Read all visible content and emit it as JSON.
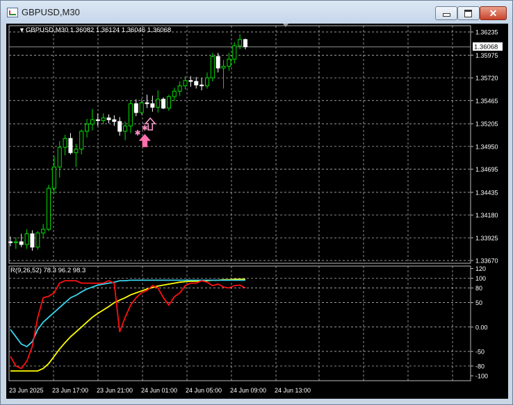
{
  "window": {
    "title": "GBPUSD,M30",
    "controls": {
      "minimize": "minimize",
      "maximize": "maximize",
      "close": "✕"
    }
  },
  "main_chart": {
    "header": "GBPUSD,M30  1.36082 1.36124 1.36046 1.36068",
    "current_price_label": "1.36068",
    "price_labels": [
      "1.36235",
      "1.35975",
      "1.35720",
      "1.35465",
      "1.35205",
      "1.34950",
      "1.34695",
      "1.34435",
      "1.34180",
      "1.33925",
      "1.33670"
    ]
  },
  "indicator": {
    "header": "R(9,26,52) 78.3 96.2 98.3",
    "scale_labels": [
      "120",
      "100",
      "80",
      "50",
      "0.00",
      "-50",
      "-80",
      "-100"
    ]
  },
  "time_axis": {
    "labels": [
      "23 Jun 2025",
      "23 Jun 17:00",
      "23 Jun 21:00",
      "24 Jun 01:00",
      "24 Jun 05:00",
      "24 Jun 09:00",
      "24 Jun 13:00"
    ]
  },
  "colors": {
    "bull": "#00e000",
    "bear": "#ffffff",
    "grid": "#cfcfcf",
    "fast_line": "#ff1010",
    "mid_line": "#3ad6ee",
    "slow_line": "#ffff00",
    "arrow": "#ff6fae",
    "arrow_outline": "#ff9fd0",
    "star": "#ff8fc0"
  },
  "chart_data": {
    "type": "candlestick",
    "symbol": "GBPUSD",
    "timeframe": "M30",
    "x": [
      "23 Jun 14:00",
      "23 Jun 14:30",
      "23 Jun 15:00",
      "23 Jun 15:30",
      "23 Jun 16:00",
      "23 Jun 16:30",
      "23 Jun 17:00",
      "23 Jun 17:30",
      "23 Jun 18:00",
      "23 Jun 18:30",
      "23 Jun 19:00",
      "23 Jun 19:30",
      "23 Jun 20:00",
      "23 Jun 20:30",
      "23 Jun 21:00",
      "23 Jun 21:30",
      "23 Jun 22:00",
      "23 Jun 22:30",
      "23 Jun 23:00",
      "23 Jun 23:30",
      "24 Jun 00:00",
      "24 Jun 00:30",
      "24 Jun 01:00",
      "24 Jun 01:30",
      "24 Jun 02:00",
      "24 Jun 02:30",
      "24 Jun 03:00",
      "24 Jun 03:30",
      "24 Jun 04:00",
      "24 Jun 04:30",
      "24 Jun 05:00",
      "24 Jun 05:30",
      "24 Jun 06:00",
      "24 Jun 06:30",
      "24 Jun 07:00",
      "24 Jun 07:30",
      "24 Jun 08:00",
      "24 Jun 08:30",
      "24 Jun 09:00",
      "24 Jun 09:30",
      "24 Jun 10:00",
      "24 Jun 10:30",
      "24 Jun 11:00",
      "24 Jun 11:30"
    ],
    "ohlc": [
      [
        1.3388,
        1.3394,
        1.3383,
        1.3387
      ],
      [
        1.3387,
        1.3393,
        1.338,
        1.3388
      ],
      [
        1.3388,
        1.3397,
        1.3382,
        1.3385
      ],
      [
        1.3385,
        1.3402,
        1.338,
        1.3397
      ],
      [
        1.3397,
        1.3401,
        1.3378,
        1.3382
      ],
      [
        1.3382,
        1.34,
        1.3379,
        1.3398
      ],
      [
        1.3398,
        1.3408,
        1.3392,
        1.3402
      ],
      [
        1.3402,
        1.3452,
        1.34,
        1.3448
      ],
      [
        1.3448,
        1.3484,
        1.3442,
        1.3472
      ],
      [
        1.3472,
        1.3501,
        1.346,
        1.3494
      ],
      [
        1.3494,
        1.3508,
        1.3485,
        1.3504
      ],
      [
        1.3504,
        1.351,
        1.3486,
        1.3488
      ],
      [
        1.3488,
        1.3498,
        1.3472,
        1.3492
      ],
      [
        1.3492,
        1.3514,
        1.3486,
        1.3512
      ],
      [
        1.3512,
        1.3526,
        1.3505,
        1.352
      ],
      [
        1.352,
        1.3537,
        1.3513,
        1.3525
      ],
      [
        1.3525,
        1.3532,
        1.3518,
        1.3524
      ],
      [
        1.3524,
        1.3532,
        1.352,
        1.3527
      ],
      [
        1.3527,
        1.3531,
        1.3521,
        1.3525
      ],
      [
        1.3525,
        1.353,
        1.3518,
        1.3523
      ],
      [
        1.3523,
        1.3528,
        1.3507,
        1.3512
      ],
      [
        1.3512,
        1.3523,
        1.3502,
        1.3518
      ],
      [
        1.3518,
        1.3547,
        1.351,
        1.3543
      ],
      [
        1.3543,
        1.3548,
        1.3529,
        1.3533
      ],
      [
        1.3533,
        1.3549,
        1.353,
        1.3544
      ],
      [
        1.3544,
        1.3553,
        1.3538,
        1.3543
      ],
      [
        1.3543,
        1.3552,
        1.3534,
        1.3539
      ],
      [
        1.3539,
        1.3558,
        1.3533,
        1.3548
      ],
      [
        1.3548,
        1.355,
        1.3537,
        1.3538
      ],
      [
        1.3538,
        1.3553,
        1.3535,
        1.3551
      ],
      [
        1.3551,
        1.3561,
        1.3546,
        1.3557
      ],
      [
        1.3557,
        1.3568,
        1.3552,
        1.3563
      ],
      [
        1.3563,
        1.3574,
        1.3559,
        1.3569
      ],
      [
        1.3569,
        1.3574,
        1.3562,
        1.3568
      ],
      [
        1.3568,
        1.3573,
        1.356,
        1.3564
      ],
      [
        1.3564,
        1.3572,
        1.3558,
        1.3563
      ],
      [
        1.3563,
        1.3578,
        1.356,
        1.3572
      ],
      [
        1.3572,
        1.36,
        1.3568,
        1.3596
      ],
      [
        1.3596,
        1.36,
        1.3578,
        1.3583
      ],
      [
        1.3583,
        1.3592,
        1.356,
        1.3585
      ],
      [
        1.3585,
        1.36,
        1.358,
        1.3593
      ],
      [
        1.3593,
        1.3612,
        1.3588,
        1.3608
      ],
      [
        1.3608,
        1.3621,
        1.3604,
        1.3615
      ],
      [
        1.3615,
        1.3616,
        1.3604,
        1.36068
      ]
    ],
    "y_range": [
      1.3367,
      1.363
    ],
    "grid": true,
    "indicator_lines": {
      "fast": [
        -60,
        -80,
        -85,
        -70,
        -40,
        20,
        60,
        63,
        70,
        90,
        95,
        95,
        95,
        90,
        90,
        90,
        90,
        90,
        95,
        90,
        -10,
        20,
        45,
        60,
        70,
        75,
        85,
        80,
        60,
        45,
        62,
        70,
        85,
        90,
        90,
        95,
        92,
        85,
        88,
        82,
        80,
        85,
        86,
        80
      ],
      "mid": [
        -5,
        -20,
        -35,
        -40,
        -30,
        -5,
        10,
        20,
        30,
        40,
        50,
        60,
        65,
        72,
        78,
        82,
        86,
        88,
        90,
        92,
        95,
        95,
        96,
        96,
        96,
        96,
        96,
        96,
        96,
        96,
        96,
        96,
        96,
        96,
        96,
        96,
        96,
        96,
        96,
        96,
        96,
        96,
        96,
        96
      ],
      "slow": [
        -90,
        -90,
        -90,
        -90,
        -90,
        -90,
        -85,
        -75,
        -60,
        -45,
        -32,
        -20,
        -10,
        0,
        10,
        20,
        28,
        35,
        42,
        50,
        55,
        60,
        66,
        70,
        74,
        78,
        81,
        84,
        86,
        88,
        90,
        92,
        93,
        94,
        94,
        95,
        95,
        96,
        96,
        97,
        97,
        98,
        98,
        98
      ]
    },
    "indicator_range": [
      -110,
      125
    ],
    "signals": [
      {
        "x": "23 Jun 23:30",
        "type": "buy-arrow"
      },
      {
        "x": "24 Jun 00:00",
        "type": "buy-arrow-outline"
      },
      {
        "x": "23 Jun 23:00",
        "type": "star"
      },
      {
        "x": "23 Jun 23:30",
        "type": "star"
      }
    ]
  }
}
